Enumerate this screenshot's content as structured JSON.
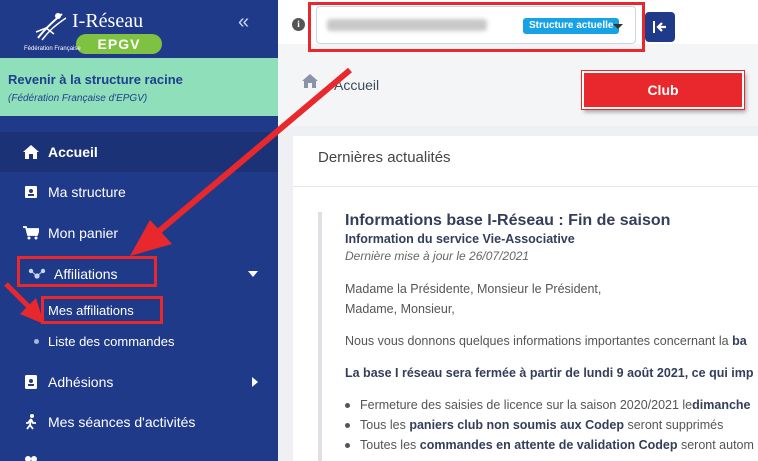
{
  "app": {
    "logo_title": "I-Réseau",
    "logo_badge": "EPGV",
    "logo_subtitle": "Fédération Française"
  },
  "sidebar": {
    "root_title": "Revenir à la structure racine",
    "root_subtitle": "(Fédération Française d'EPGV)",
    "items": [
      {
        "label": "Accueil",
        "icon": "home-icon",
        "active": true
      },
      {
        "label": "Ma structure",
        "icon": "id-card-icon"
      },
      {
        "label": "Mon panier",
        "icon": "cart-icon"
      },
      {
        "label": "Affiliations",
        "icon": "network-icon",
        "expanded": true
      },
      {
        "label": "Adhésions",
        "icon": "id-badge-icon"
      },
      {
        "label": "Mes séances d'activités",
        "icon": "running-icon"
      }
    ],
    "sub_items": [
      {
        "label": "Mes affiliations"
      },
      {
        "label": "Liste des commandes"
      }
    ]
  },
  "topbar": {
    "structure_badge": "Structure actuelle"
  },
  "breadcrumb": {
    "label": "Accueil"
  },
  "news": {
    "heading": "Dernières actualités",
    "title": "Informations base I-Réseau : Fin de saison",
    "subtitle": "Information du service Vie-Associative",
    "date": "Dernière mise à jour le 26/07/2021",
    "p1": "Madame la Présidente, Monsieur le Président,",
    "p2": "Madame, Monsieur,",
    "p3": "Nous vous donnons quelques informations importantes concernant la",
    "p3_bold": "ba",
    "p4": "La base I réseau sera fermée à partir de lundi 9 août 2021, ce qui imp",
    "bullet1_pre": "Fermeture des saisies de licence sur la saison 2020/2021 le ",
    "bullet1_bold": "dimanche",
    "bullet2_pre": "Tous les ",
    "bullet2_bold": "paniers club non soumis aux Codep",
    "bullet2_post": " seront supprimés",
    "bullet3_pre": "Toutes les ",
    "bullet3_bold": "commandes en attente de validation Codep",
    "bullet3_post": " seront autom"
  },
  "annotation": {
    "club_label": "Club",
    "color": "#e8282c"
  },
  "colors": {
    "sidebar": "#203a8a",
    "root_block": "#8fe0ba",
    "badge": "#17a2e6",
    "logo_badge": "#7fc242"
  }
}
